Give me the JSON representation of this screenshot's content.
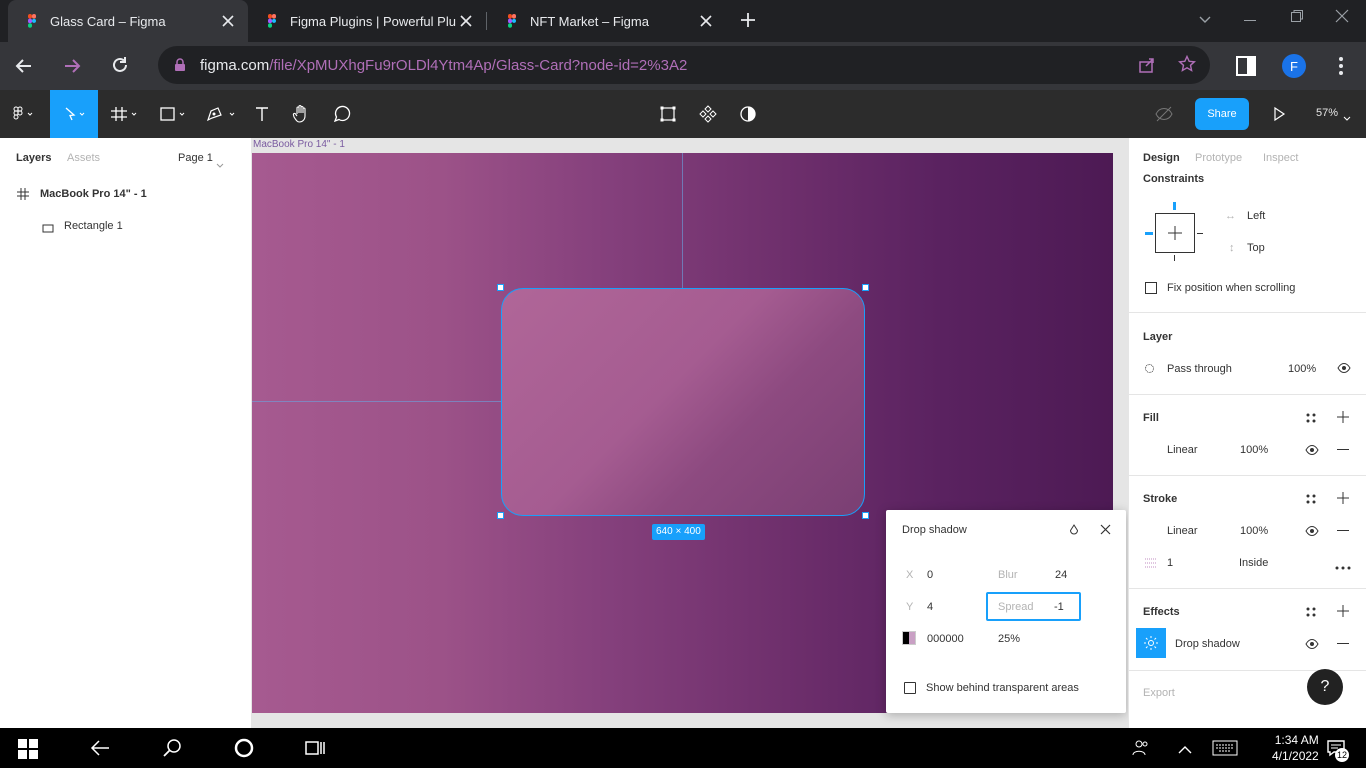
{
  "browser": {
    "tabs": [
      {
        "title": "Glass Card – Figma",
        "active": true
      },
      {
        "title": "Figma Plugins | Powerful Plugin",
        "active": false
      },
      {
        "title": "NFT Market – Figma",
        "active": false
      }
    ],
    "url_host": "figma.com",
    "url_path": "/file/XpMUXhgFu9rOLDl4Ytm4Ap/Glass-Card?node-id=2%3A2",
    "profile_initial": "F"
  },
  "toolbar": {
    "share_label": "Share",
    "zoom": "57%"
  },
  "left_panel": {
    "tab_layers": "Layers",
    "tab_assets": "Assets",
    "page": "Page 1",
    "layers": [
      {
        "label": "MacBook Pro 14\" - 1"
      },
      {
        "label": "Rectangle 1"
      }
    ]
  },
  "canvas": {
    "frame_label": "MacBook Pro 14\" - 1",
    "dimensions": "640 × 400"
  },
  "shadow_popup": {
    "title": "Drop shadow",
    "x_label": "X",
    "x_value": "0",
    "y_label": "Y",
    "y_value": "4",
    "blur_label": "Blur",
    "blur_value": "24",
    "spread_label": "Spread",
    "spread_value": "-1",
    "color_hex": "000000",
    "color_opacity": "25%",
    "show_behind_label": "Show behind transparent areas"
  },
  "right_panel": {
    "tab_design": "Design",
    "tab_prototype": "Prototype",
    "tab_inspect": "Inspect",
    "constraints_title": "Constraints",
    "constraint_h": "Left",
    "constraint_v": "Top",
    "fix_position_label": "Fix position when scrolling",
    "layer_title": "Layer",
    "blend_mode": "Pass through",
    "layer_opacity": "100%",
    "fill_title": "Fill",
    "fill_type": "Linear",
    "fill_opacity": "100%",
    "stroke_title": "Stroke",
    "stroke_type": "Linear",
    "stroke_opacity": "100%",
    "stroke_weight": "1",
    "stroke_align": "Inside",
    "effects_title": "Effects",
    "effect_type": "Drop shadow",
    "export_title": "Export",
    "help_label": "?"
  },
  "taskbar": {
    "time": "1:34 AM",
    "date": "4/1/2022",
    "notification_count": "12"
  },
  "colors": {
    "accent": "#18a0fb",
    "chrome_bg": "#202124",
    "toolbar_bg": "#2c2c2c"
  }
}
